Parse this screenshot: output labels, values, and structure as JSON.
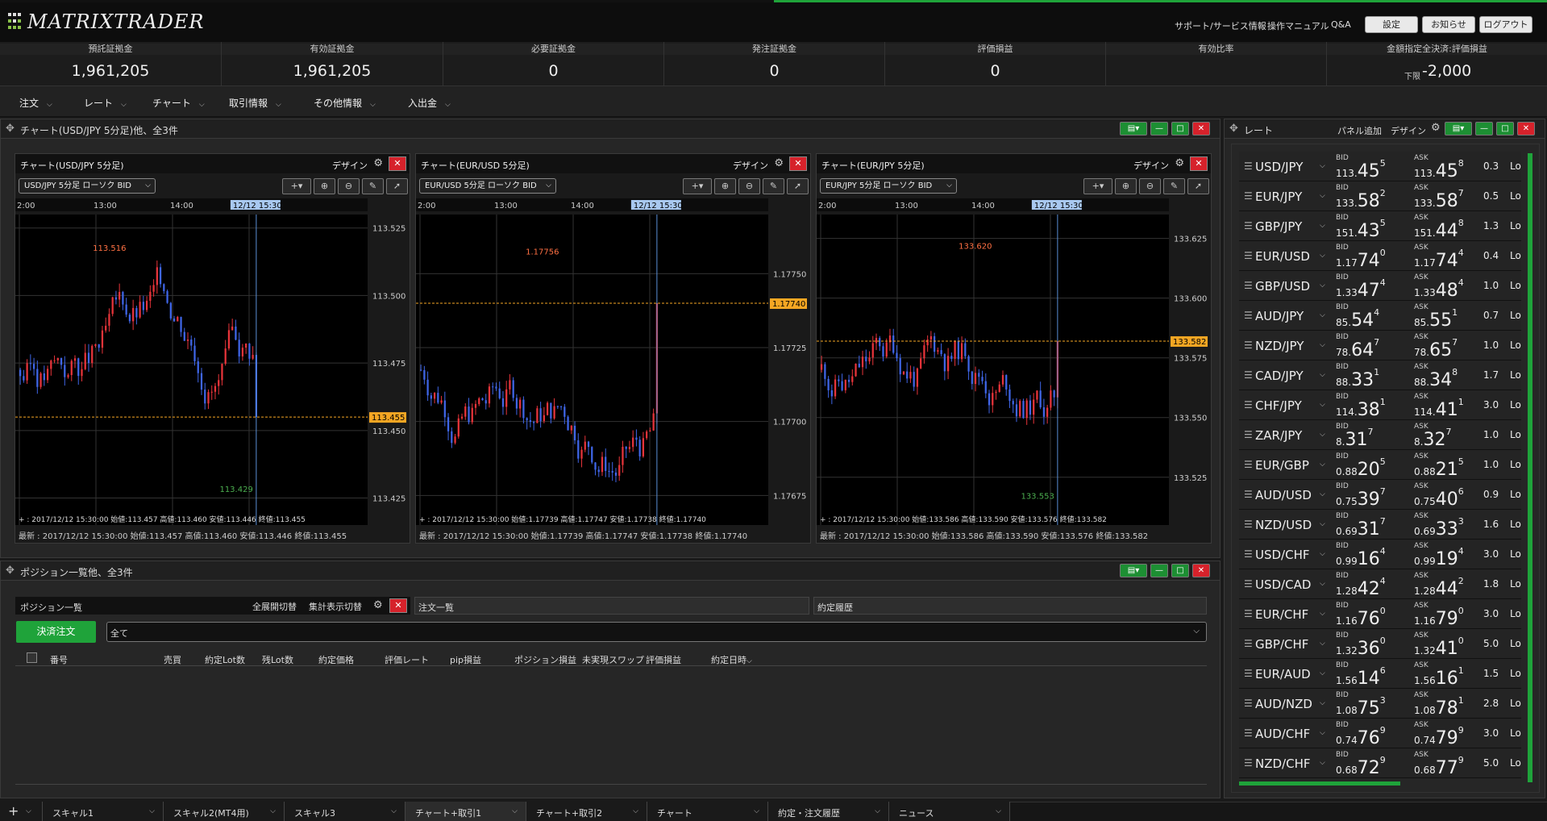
{
  "app": {
    "logo_text": "MATRIXTRADER"
  },
  "top_links": [
    "サポート/サービス情報",
    "操作マニュアル",
    "Q&A"
  ],
  "top_buttons": [
    "設定",
    "お知らせ",
    "ログアウト"
  ],
  "summary": [
    {
      "label": "預託証拠金",
      "value": "1,961,205"
    },
    {
      "label": "有効証拠金",
      "value": "1,961,205"
    },
    {
      "label": "必要証拠金",
      "value": "0"
    },
    {
      "label": "発注証拠金",
      "value": "0"
    },
    {
      "label": "評価損益",
      "value": "0"
    },
    {
      "label": "有効比率",
      "value": ""
    },
    {
      "label": "金額指定全決済:評価損益",
      "value": "-2,000",
      "sub": "下限"
    }
  ],
  "menu": [
    "注文",
    "レート",
    "チャート",
    "取引情報",
    "その他情報",
    "入出金"
  ],
  "chart_panel": {
    "title": "チャート(USD/JPY 5分足)他、全3件"
  },
  "charts": [
    {
      "title": "チャート(USD/JPY 5分足)",
      "design": "デザイン",
      "select": "USD/JPY 5分足 ローソク BID",
      "times": [
        "2:00",
        "13:00",
        "14:00",
        "15:00"
      ],
      "cursor_time": "12/12 15:30",
      "yticks": [
        "113.525",
        "113.500",
        "113.475",
        "113.450",
        "113.425"
      ],
      "ymin": 113.415,
      "ymax": 113.53,
      "high": 113.516,
      "low": 113.429,
      "high_label": "113.516",
      "low_label": "113.429",
      "current": "113.455",
      "current_val": 113.455,
      "ohlc_line": "+ : 2017/12/12 15:30:00  始値:113.457  高値:113.460  安値:113.446  終値:113.455",
      "foot": "最新 : 2017/12/12 15:30:00  始値:113.457  高値:113.460  安値:113.446  終値:113.455",
      "seed": 3
    },
    {
      "title": "チャート(EUR/USD 5分足)",
      "design": "デザイン",
      "select": "EUR/USD 5分足 ローソク BID",
      "times": [
        "2:00",
        "13:00",
        "14:00",
        "15:00"
      ],
      "cursor_time": "12/12 15:30",
      "yticks": [
        "1.17750",
        "1.17725",
        "1.17700",
        "1.17675"
      ],
      "ymin": 1.17665,
      "ymax": 1.1777,
      "high": 1.17756,
      "low": 1.17672,
      "high_label": "1.17756",
      "low_label": "",
      "current": "1.17740",
      "current_val": 1.1774,
      "ohlc_line": "+ : 2017/12/12 15:30:00  始値:1.17739  高値:1.17747  安値:1.17738  終値:1.17740",
      "foot": "最新 : 2017/12/12 15:30:00  始値:1.17739  高値:1.17747  安値:1.17738  終値:1.17740",
      "seed": 7
    },
    {
      "title": "チャート(EUR/JPY 5分足)",
      "design": "デザイン",
      "select": "EUR/JPY 5分足 ローソク BID",
      "times": [
        "2:00",
        "13:00",
        "14:00",
        "15:00"
      ],
      "cursor_time": "12/12 15:30",
      "yticks": [
        "133.625",
        "133.600",
        "133.575",
        "133.550",
        "133.525"
      ],
      "ymin": 133.505,
      "ymax": 133.635,
      "high": 133.62,
      "low": 133.518,
      "high_label": "133.620",
      "low_label": "133.553",
      "current": "133.582",
      "current_val": 133.582,
      "ohlc_line": "+ : 2017/12/12 15:30:00  始値:133.586  高値:133.590  安値:133.576  終値:133.582",
      "foot": "最新 : 2017/12/12 15:30:00  始値:133.586  高値:133.590  安値:133.576  終値:133.582",
      "seed": 11
    }
  ],
  "position_panel": {
    "title": "ポジション一覧他、全3件",
    "sub_title": "ポジション一覧",
    "expand": "全展開切替",
    "summary_toggle": "集計表示切替",
    "order_list": "注文一覧",
    "history": "約定履歴",
    "settle_button": "決済注文",
    "filter": "全て",
    "columns": [
      "番号",
      "売買",
      "約定Lot数",
      "残Lot数",
      "約定価格",
      "評価レート",
      "pip損益",
      "ポジション損益",
      "未実現スワップ",
      "評価損益",
      "約定日時"
    ]
  },
  "rate_panel": {
    "title": "レート",
    "add_panel": "パネル追加",
    "design": "デザイン"
  },
  "rates": [
    {
      "pair": "USD/JPY",
      "bid": [
        "113.",
        "45",
        "5"
      ],
      "ask": [
        "113.",
        "45",
        "8"
      ],
      "spread": "0.3"
    },
    {
      "pair": "EUR/JPY",
      "bid": [
        "133.",
        "58",
        "2"
      ],
      "ask": [
        "133.",
        "58",
        "7"
      ],
      "spread": "0.5"
    },
    {
      "pair": "GBP/JPY",
      "bid": [
        "151.",
        "43",
        "5"
      ],
      "ask": [
        "151.",
        "44",
        "8"
      ],
      "spread": "1.3"
    },
    {
      "pair": "EUR/USD",
      "bid": [
        "1.17",
        "74",
        "0"
      ],
      "ask": [
        "1.17",
        "74",
        "4"
      ],
      "spread": "0.4"
    },
    {
      "pair": "GBP/USD",
      "bid": [
        "1.33",
        "47",
        "4"
      ],
      "ask": [
        "1.33",
        "48",
        "4"
      ],
      "spread": "1.0"
    },
    {
      "pair": "AUD/JPY",
      "bid": [
        "85.",
        "54",
        "4"
      ],
      "ask": [
        "85.",
        "55",
        "1"
      ],
      "spread": "0.7"
    },
    {
      "pair": "NZD/JPY",
      "bid": [
        "78.",
        "64",
        "7"
      ],
      "ask": [
        "78.",
        "65",
        "7"
      ],
      "spread": "1.0"
    },
    {
      "pair": "CAD/JPY",
      "bid": [
        "88.",
        "33",
        "1"
      ],
      "ask": [
        "88.",
        "34",
        "8"
      ],
      "spread": "1.7"
    },
    {
      "pair": "CHF/JPY",
      "bid": [
        "114.",
        "38",
        "1"
      ],
      "ask": [
        "114.",
        "41",
        "1"
      ],
      "spread": "3.0"
    },
    {
      "pair": "ZAR/JPY",
      "bid": [
        "8.",
        "31",
        "7"
      ],
      "ask": [
        "8.",
        "32",
        "7"
      ],
      "spread": "1.0"
    },
    {
      "pair": "EUR/GBP",
      "bid": [
        "0.88",
        "20",
        "5"
      ],
      "ask": [
        "0.88",
        "21",
        "5"
      ],
      "spread": "1.0"
    },
    {
      "pair": "AUD/USD",
      "bid": [
        "0.75",
        "39",
        "7"
      ],
      "ask": [
        "0.75",
        "40",
        "6"
      ],
      "spread": "0.9"
    },
    {
      "pair": "NZD/USD",
      "bid": [
        "0.69",
        "31",
        "7"
      ],
      "ask": [
        "0.69",
        "33",
        "3"
      ],
      "spread": "1.6"
    },
    {
      "pair": "USD/CHF",
      "bid": [
        "0.99",
        "16",
        "4"
      ],
      "ask": [
        "0.99",
        "19",
        "4"
      ],
      "spread": "3.0"
    },
    {
      "pair": "USD/CAD",
      "bid": [
        "1.28",
        "42",
        "4"
      ],
      "ask": [
        "1.28",
        "44",
        "2"
      ],
      "spread": "1.8"
    },
    {
      "pair": "EUR/CHF",
      "bid": [
        "1.16",
        "76",
        "0"
      ],
      "ask": [
        "1.16",
        "79",
        "0"
      ],
      "spread": "3.0"
    },
    {
      "pair": "GBP/CHF",
      "bid": [
        "1.32",
        "36",
        "0"
      ],
      "ask": [
        "1.32",
        "41",
        "0"
      ],
      "spread": "5.0"
    },
    {
      "pair": "EUR/AUD",
      "bid": [
        "1.56",
        "14",
        "6"
      ],
      "ask": [
        "1.56",
        "16",
        "1"
      ],
      "spread": "1.5"
    },
    {
      "pair": "AUD/NZD",
      "bid": [
        "1.08",
        "75",
        "3"
      ],
      "ask": [
        "1.08",
        "78",
        "1"
      ],
      "spread": "2.8"
    },
    {
      "pair": "AUD/CHF",
      "bid": [
        "0.74",
        "76",
        "9"
      ],
      "ask": [
        "0.74",
        "79",
        "9"
      ],
      "spread": "3.0"
    },
    {
      "pair": "NZD/CHF",
      "bid": [
        "0.68",
        "72",
        "9"
      ],
      "ask": [
        "0.68",
        "77",
        "9"
      ],
      "spread": "5.0"
    }
  ],
  "rate_labels": {
    "bid": "BID",
    "ask": "ASK",
    "lo": "Lo"
  },
  "bottom_tabs": [
    "スキャル1",
    "スキャル2(MT4用)",
    "スキャル3",
    "チャート+取引1",
    "チャート+取引2",
    "チャート",
    "約定・注文履歴",
    "ニュース"
  ],
  "active_tab": 3,
  "colors": {
    "up": "#e8343a",
    "down": "#3f66e8",
    "accent": "#1d8f33",
    "current_line": "#f5a623"
  }
}
